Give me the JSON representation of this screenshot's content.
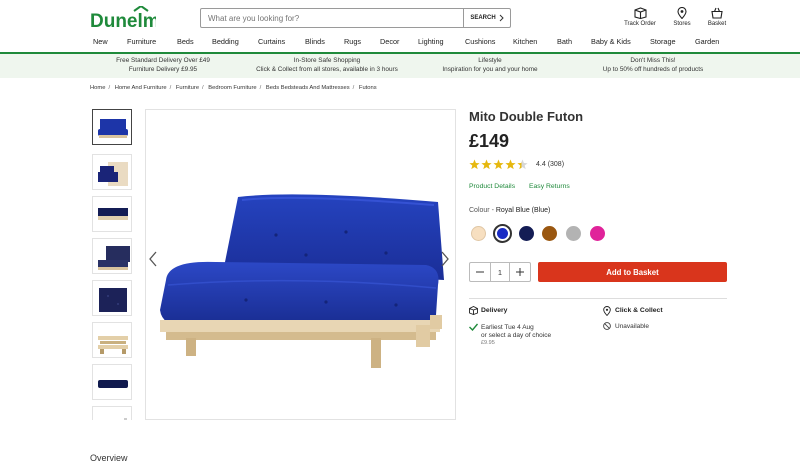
{
  "brand": {
    "name": "Dunelm",
    "color": "#1f8a3b"
  },
  "search": {
    "placeholder": "What are you looking for?",
    "button_label": "SEARCH"
  },
  "header_icons": [
    {
      "label": "Track Order",
      "icon": "box-icon"
    },
    {
      "label": "Stores",
      "icon": "location-pin-icon"
    },
    {
      "label": "Basket",
      "icon": "basket-icon"
    }
  ],
  "nav": [
    "New",
    "Furniture",
    "Beds",
    "Bedding",
    "Curtains",
    "Blinds",
    "Rugs",
    "Decor",
    "Lighting",
    "Cushions",
    "Kitchen",
    "Bath",
    "Baby & Kids",
    "Storage",
    "Garden"
  ],
  "promos": [
    {
      "line1": "Free Standard Delivery Over £49",
      "line2": "Furniture Delivery £9.95"
    },
    {
      "line1": "In-Store Safe Shopping",
      "line2": "Click & Collect from all stores, available in 3 hours"
    },
    {
      "line1": "Lifestyle",
      "line2": "Inspiration for you and your home"
    },
    {
      "line1": "Don't Miss This!",
      "line2": "Up to 50% off hundreds of products"
    }
  ],
  "breadcrumb": [
    "Home",
    "Home And Furniture",
    "Furniture",
    "Bedroom Furniture",
    "Beds Bedsteads And Mattresses",
    "Futons"
  ],
  "product": {
    "title": "Mito Double Futon",
    "price": "£149",
    "rating": "4.4",
    "review_count": "(308)",
    "rating_value": 4.4,
    "links": [
      "Product Details",
      "Easy Returns"
    ],
    "colour_label": "Colour",
    "colour_value": "Royal Blue (Blue)",
    "swatches": [
      {
        "name": "natural",
        "color": "#f7dfc0"
      },
      {
        "name": "royal-blue",
        "color": "#1a2bc4",
        "selected": true
      },
      {
        "name": "navy",
        "color": "#141d55"
      },
      {
        "name": "brown",
        "color": "#9a5710"
      },
      {
        "name": "grey",
        "color": "#b3b3b3"
      },
      {
        "name": "pink",
        "color": "#e0239a"
      }
    ],
    "quantity": "1",
    "add_to_basket": "Add to Basket"
  },
  "delivery": {
    "title": "Delivery",
    "line1": "Earliest Tue 4 Aug",
    "line2": "or select a day of choice",
    "price": "£9.95"
  },
  "click_collect": {
    "title": "Click & Collect",
    "status": "Unavailable"
  },
  "section_heading": "Overview",
  "colors": {
    "accent_green": "#1f8a3b",
    "cta_red": "#d9351c",
    "futon_blue": "#1d35a8",
    "wood": "#e8d4b0"
  }
}
